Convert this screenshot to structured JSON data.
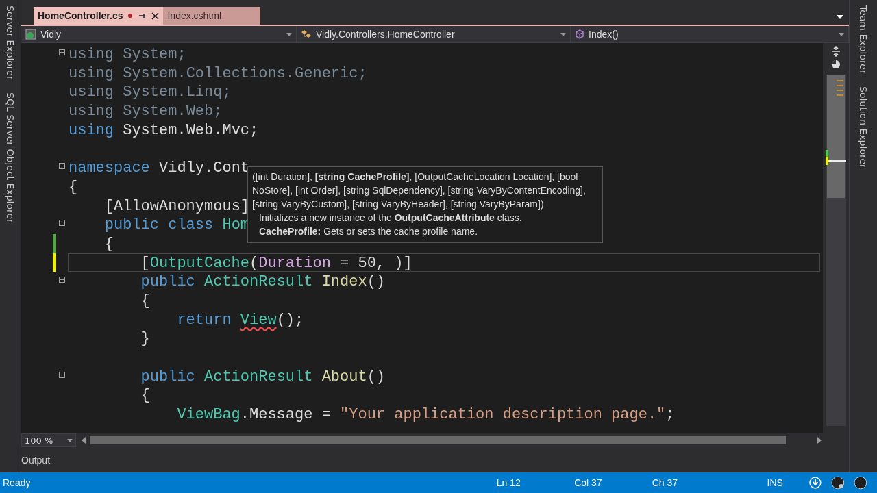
{
  "left_panels": [
    "Server Explorer",
    "SQL Server Object Explorer"
  ],
  "right_panels": [
    "Team Explorer",
    "Solution Explorer"
  ],
  "tabs": [
    {
      "label": "HomeController.cs",
      "selected": true,
      "modified": true
    },
    {
      "label": "Index.cshtml",
      "selected": false,
      "modified": false
    }
  ],
  "nav": {
    "project": "Vidly",
    "type": "Vidly.Controllers.HomeController",
    "member": "Index()"
  },
  "code": [
    {
      "fold": true,
      "tokens": [
        {
          "kind": "unused",
          "text": "using "
        },
        {
          "kind": "unused",
          "text": "System;"
        }
      ]
    },
    {
      "fold": false,
      "tokens": [
        {
          "kind": "unused",
          "text": "using "
        },
        {
          "kind": "unused",
          "text": "System.Collections.Generic;"
        }
      ]
    },
    {
      "fold": false,
      "tokens": [
        {
          "kind": "unused",
          "text": "using "
        },
        {
          "kind": "unused",
          "text": "System.Linq;"
        }
      ]
    },
    {
      "fold": false,
      "tokens": [
        {
          "kind": "unused",
          "text": "using "
        },
        {
          "kind": "unused",
          "text": "System.Web;"
        }
      ]
    },
    {
      "fold": false,
      "tokens": [
        {
          "kind": "keyword",
          "text": "using "
        },
        {
          "kind": "plain",
          "text": "System.Web.Mvc;"
        }
      ]
    },
    {
      "fold": false
    },
    {
      "fold": true,
      "tokens": [
        {
          "kind": "keyword",
          "text": "namespace "
        },
        {
          "kind": "plain",
          "text": "Vidly.Cont"
        }
      ]
    },
    {
      "fold": false,
      "tokens": [
        {
          "kind": "plain",
          "text": "{"
        }
      ],
      "children": [
        {
          "fold": false,
          "tokens": [
            {
              "kind": "plain",
              "text": "[AllowAnonymous]"
            }
          ]
        },
        {
          "fold": true,
          "tokens": [
            {
              "kind": "keyword",
              "text": "public "
            },
            {
              "kind": "keyword",
              "text": "class "
            },
            {
              "kind": "type",
              "text": "Hom"
            }
          ]
        },
        {
          "fold": false,
          "modified": true,
          "saved": true,
          "tokens": [
            {
              "kind": "plain",
              "text": "{"
            }
          ],
          "children": [
            {
              "fold": false,
              "modified": true,
              "saved": false,
              "current": true,
              "tokens": [
                {
                  "kind": "plain",
                  "text": "["
                },
                {
                  "kind": "type",
                  "text": "OutputCache"
                },
                {
                  "kind": "plain",
                  "text": "("
                },
                {
                  "kind": "param",
                  "text": "Duration "
                },
                {
                  "kind": "plain",
                  "text": "= "
                },
                {
                  "kind": "plain",
                  "text": "50, "
                },
                {
                  "kind": "plain",
                  "text": ")]"
                }
              ]
            },
            {
              "fold": true,
              "tokens": [
                {
                  "kind": "keyword",
                  "text": "public "
                },
                {
                  "kind": "type",
                  "text": "ActionResult "
                },
                {
                  "kind": "method",
                  "text": "Index"
                },
                {
                  "kind": "plain",
                  "text": "()"
                }
              ]
            },
            {
              "fold": false,
              "tokens": [
                {
                  "kind": "plain",
                  "text": "{"
                }
              ],
              "children": [
                {
                  "fold": false,
                  "tokens": [
                    {
                      "kind": "keyword",
                      "text": "return "
                    },
                    {
                      "kind": "error",
                      "text": "View"
                    },
                    {
                      "kind": "plain",
                      "text": "();"
                    }
                  ]
                }
              ]
            },
            {
              "fold": false,
              "tokens": [
                {
                  "kind": "plain",
                  "text": "}"
                }
              ]
            },
            {
              "fold": false
            },
            {
              "fold": true,
              "tokens": [
                {
                  "kind": "keyword",
                  "text": "public "
                },
                {
                  "kind": "type",
                  "text": "ActionResult "
                },
                {
                  "kind": "method",
                  "text": "About"
                },
                {
                  "kind": "plain",
                  "text": "()"
                }
              ]
            },
            {
              "fold": false,
              "tokens": [
                {
                  "kind": "plain",
                  "text": "{"
                }
              ],
              "children": [
                {
                  "fold": false,
                  "tokens": [
                    {
                      "kind": "type",
                      "text": "ViewBag"
                    },
                    {
                      "kind": "plain",
                      "text": ".Message "
                    },
                    {
                      "kind": "plain",
                      "text": "= "
                    },
                    {
                      "kind": "string",
                      "text": "\"Your application description page.\""
                    },
                    {
                      "kind": "plain",
                      "text": ";"
                    }
                  ]
                }
              ]
            }
          ]
        }
      ]
    }
  ],
  "tooltip": {
    "signature": "([int Duration], **[string CacheProfile]**, [OutputCacheLocation Location], [bool NoStore], [int Order], [string SqlDependency], [string VaryByContentEncoding], [string VaryByCustom], [string VaryByHeader], [string VaryByParam])",
    "summary": "Initializes a new instance of the **OutputCacheAttribute** class.",
    "param_help": "**CacheProfile:** Gets or sets the cache profile name."
  },
  "zoom": "100 %",
  "output_tab": "Output",
  "status": {
    "message": "Ready",
    "line": "Ln 12",
    "col": "Col 37",
    "ch": "Ch 37",
    "mode": "INS"
  }
}
